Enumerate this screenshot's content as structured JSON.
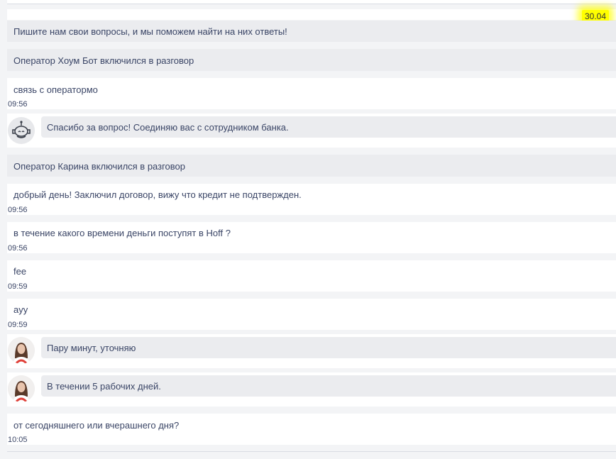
{
  "date": "30.04",
  "messages": {
    "m1": {
      "text": "Пишите нам свои вопросы, и мы поможем найти на них ответы!"
    },
    "m2": {
      "text": "Оператор Хоум Бот включился в разговор"
    },
    "m3": {
      "text": "связь с оператормо",
      "time": "09:56"
    },
    "m4": {
      "text": "Спасибо за вопрос! Соединяю вас с сотрудником банка.",
      "avatar": "robot-icon"
    },
    "m5": {
      "text": "Оператор Карина включился в разговор"
    },
    "m6": {
      "text": "добрый день! Заключил договор, вижу что кредит не подтвержден.",
      "time": "09:56"
    },
    "m7": {
      "text": "в течение какого времени деньги поступят в Hoff ?",
      "time": "09:56"
    },
    "m8": {
      "text": "fee",
      "time": "09:59"
    },
    "m9": {
      "text": "ayy",
      "time": "09:59"
    },
    "m10": {
      "text": "Пару минут, уточняю",
      "avatar": "operator-avatar"
    },
    "m11": {
      "text": "В течении 5 рабочих дней.",
      "avatar": "operator-avatar"
    },
    "m12": {
      "text": "от сегодняшнего или вчерашнего дня?",
      "time": "10:05"
    }
  }
}
